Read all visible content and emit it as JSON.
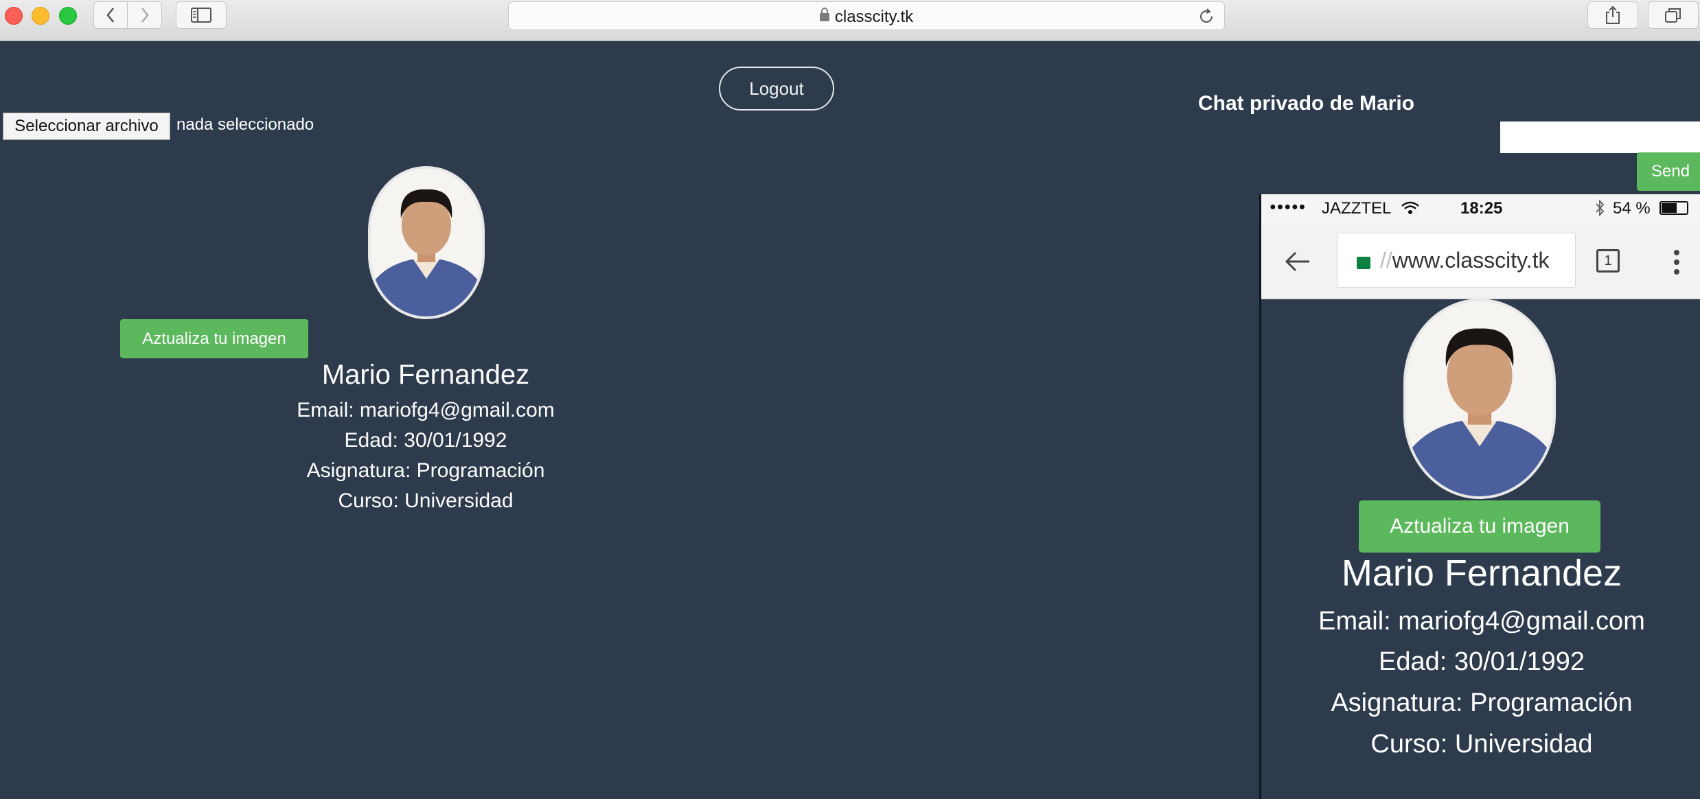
{
  "browser": {
    "url": "classcity.tk"
  },
  "page": {
    "logout_label": "Logout",
    "file_button_label": "Seleccionar archivo",
    "file_status": "nada seleccionado",
    "update_image_label": "Aztualiza tu imagen",
    "profile": {
      "name": "Mario Fernandez",
      "email": "Email: mariofg4@gmail.com",
      "age": "Edad: 30/01/1992",
      "subject": "Asignatura: Programación",
      "course": "Curso: Universidad"
    },
    "chat": {
      "title": "Chat privado de Mario",
      "input_value": "",
      "send_label": "Send"
    }
  },
  "phone": {
    "carrier": "JAZZTEL",
    "time": "18:25",
    "battery": "54 %",
    "url_faded": "//",
    "url_visible": "www.classcity.tk",
    "tab_count": "1",
    "update_image_label": "Aztualiza tu imagen",
    "profile": {
      "name": "Mario Fernandez",
      "email": "Email: mariofg4@gmail.com",
      "age": "Edad: 30/01/1992",
      "subject": "Asignatura: Programación",
      "course": "Curso: Universidad"
    }
  }
}
